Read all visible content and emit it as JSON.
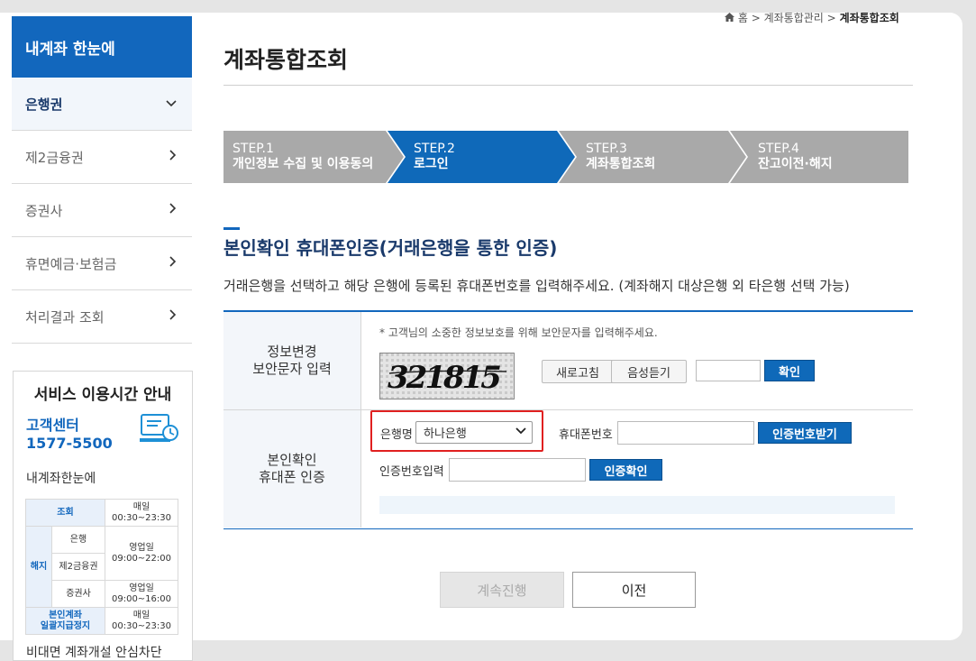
{
  "breadcrumb": {
    "home": "홈",
    "level1": "계좌통합관리",
    "current": "계좌통합조회"
  },
  "page_title": "계좌통합조회",
  "sidebar": {
    "brand": "내계좌 한눈에",
    "items": [
      {
        "label": "은행권",
        "active": true,
        "chevron": "chevron-down-icon"
      },
      {
        "label": "제2금융권",
        "active": false,
        "chevron": "chevron-right-icon"
      },
      {
        "label": "증권사",
        "active": false,
        "chevron": "chevron-right-icon"
      },
      {
        "label": "휴면예금·보험금",
        "active": false,
        "chevron": "chevron-right-icon"
      },
      {
        "label": "처리결과 조회",
        "active": false,
        "chevron": "chevron-right-icon"
      }
    ]
  },
  "service_hours": {
    "title": "서비스 이용시간 안내",
    "cc_label": "고객센터",
    "cc_phone": "1577-5500",
    "subtitle": "내계좌한눈에",
    "rows": {
      "lookup": "조회",
      "lookup_time": "매일\n00:30~23:30",
      "cancel": "해지",
      "bank": "은행",
      "bank_time": "영업일\n09:00~22:00",
      "second": "제2금융권",
      "securities": "증권사",
      "securities_time": "영업일\n09:00~16:00",
      "bulk": "본인계좌\n일괄지급정지",
      "bulk_time": "매일\n00:30~23:30"
    },
    "bottom_text": "비대면 계좌개설 안심차단"
  },
  "steps": [
    {
      "num": "STEP.1",
      "title": "개인정보 수집 및 이용동의",
      "active": false
    },
    {
      "num": "STEP.2",
      "title": "로그인",
      "active": true
    },
    {
      "num": "STEP.3",
      "title": "계좌통합조회",
      "active": false
    },
    {
      "num": "STEP.4",
      "title": "잔고이전·해지",
      "active": false
    }
  ],
  "section": {
    "title": "본인확인 휴대폰인증(거래은행을 통한 인증)",
    "desc": "거래은행을 선택하고 해당 은행에 등록된 휴대폰번호를 입력해주세요. (계좌해지 대상은행 외 타은행 선택 가능)"
  },
  "captcha_row": {
    "label1": "정보변경",
    "label2": "보안문자 입력",
    "note": "* 고객님의 소중한 정보보호를 위해 보안문자를 입력해주세요.",
    "captcha_text": "321815",
    "refresh": "새로고침",
    "audio": "음성듣기",
    "input_value": "",
    "confirm": "확인"
  },
  "phone_row": {
    "label1": "본인확인",
    "label2": "휴대폰 인증",
    "bank_label": "은행명",
    "bank_selected": "하나은행",
    "phone_label": "휴대폰번호",
    "phone_value": "",
    "request_code": "인증번호받기",
    "code_label": "인증번호입력",
    "code_value": "",
    "verify": "인증확인"
  },
  "buttons": {
    "continue": "계속진행",
    "prev": "이전"
  },
  "colors": {
    "primary": "#0f69b9",
    "step_inactive": "#a9a9a9",
    "highlight": "#e02020"
  }
}
